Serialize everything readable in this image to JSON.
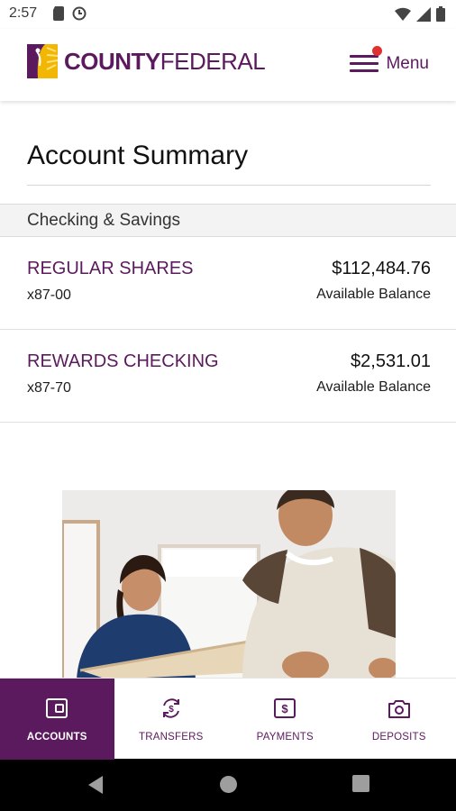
{
  "status_bar": {
    "time": "2:57",
    "left_icons": [
      "sd-card-icon",
      "data-saver-icon"
    ],
    "right_icons": [
      "wifi-icon",
      "signal-icon",
      "battery-icon"
    ]
  },
  "header": {
    "logo_text_bold": "COUNTY",
    "logo_text_regular": "FEDERAL",
    "menu_label": "Menu",
    "menu_badge_color": "#e03131"
  },
  "page": {
    "title": "Account Summary"
  },
  "section": {
    "label": "Checking & Savings"
  },
  "accounts": [
    {
      "name": "REGULAR SHARES",
      "number": "x87-00",
      "balance": "$112,484.76",
      "balance_label": "Available Balance"
    },
    {
      "name": "REWARDS CHECKING",
      "number": "x87-70",
      "balance": "$2,531.01",
      "balance_label": "Available Balance"
    }
  ],
  "bottom_nav": {
    "items": [
      {
        "label": "ACCOUNTS",
        "icon": "wallet-icon",
        "active": true
      },
      {
        "label": "TRANSFERS",
        "icon": "transfer-icon",
        "active": false
      },
      {
        "label": "PAYMENTS",
        "icon": "dollar-bill-icon",
        "active": false
      },
      {
        "label": "DEPOSITS",
        "icon": "camera-icon",
        "active": false
      }
    ]
  },
  "colors": {
    "brand_purple": "#5c1a5e",
    "logo_gold": "#f2b705"
  }
}
